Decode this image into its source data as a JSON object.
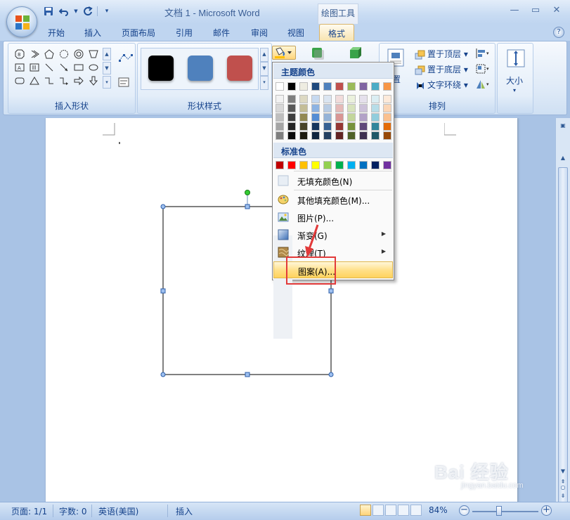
{
  "window": {
    "title": "文档 1 - Microsoft Word",
    "context_tab_group": "绘图工具",
    "controls": [
      "minimize",
      "maximize",
      "close"
    ]
  },
  "quick_access": {
    "items": [
      {
        "name": "save-icon"
      },
      {
        "name": "undo-icon"
      },
      {
        "name": "redo-icon"
      },
      {
        "name": "customize-icon"
      }
    ]
  },
  "tabs": [
    {
      "label": "开始"
    },
    {
      "label": "插入"
    },
    {
      "label": "页面布局"
    },
    {
      "label": "引用"
    },
    {
      "label": "邮件"
    },
    {
      "label": "审阅"
    },
    {
      "label": "视图"
    },
    {
      "label": "格式",
      "active": true
    }
  ],
  "ribbon": {
    "insert_shapes": {
      "label": "插入形状"
    },
    "shape_styles": {
      "label": "形状样式",
      "swatches": [
        {
          "color": "#000000"
        },
        {
          "color": "#4f81bd"
        },
        {
          "color": "#c0504d"
        }
      ]
    },
    "position_label": "置",
    "arrange": {
      "label": "排列",
      "items": [
        "置于顶层",
        "置于底层",
        "文字环绕"
      ]
    },
    "size": {
      "label": "大小"
    }
  },
  "fill_menu": {
    "theme_colors_header": "主题颜色",
    "theme_colors": [
      [
        "#ffffff",
        "#000000",
        "#eeece1",
        "#1f497d",
        "#4f81bd",
        "#c0504d",
        "#9bbb59",
        "#8064a2",
        "#4bacc6",
        "#f79646"
      ],
      [
        "#f2f2f2",
        "#7f7f7f",
        "#ddd9c3",
        "#c6d9f0",
        "#dbe5f1",
        "#f2dcdb",
        "#ebf1dd",
        "#e5e0ec",
        "#dbeef3",
        "#fdeada"
      ],
      [
        "#d8d8d8",
        "#595959",
        "#c4bd97",
        "#8db3e2",
        "#b8cce4",
        "#e5b9b7",
        "#d7e3bc",
        "#ccc1d9",
        "#b7dde8",
        "#fbd5b5"
      ],
      [
        "#bfbfbf",
        "#3f3f3f",
        "#938953",
        "#548dd4",
        "#95b3d7",
        "#d99694",
        "#c3d69b",
        "#b2a2c7",
        "#92cddc",
        "#fac08f"
      ],
      [
        "#a5a5a5",
        "#262626",
        "#494429",
        "#17365d",
        "#366092",
        "#953734",
        "#76923c",
        "#5f497a",
        "#31859b",
        "#e36c09"
      ],
      [
        "#7f7f7f",
        "#0c0c0c",
        "#1d1b10",
        "#0f243e",
        "#244061",
        "#632423",
        "#4f6128",
        "#3f3151",
        "#205867",
        "#974806"
      ]
    ],
    "standard_colors_header": "标准色",
    "standard_colors": [
      "#c00000",
      "#ff0000",
      "#ffc000",
      "#ffff00",
      "#92d050",
      "#00b050",
      "#00b0f0",
      "#0070c0",
      "#002060",
      "#7030a0"
    ],
    "items": [
      {
        "label": "无填充颜色(N)",
        "icon": "no-fill-icon"
      },
      {
        "label": "其他填充颜色(M)...",
        "icon": "palette-icon"
      },
      {
        "label": "图片(P)...",
        "icon": "picture-icon"
      },
      {
        "label": "渐变(G)",
        "icon": "gradient-icon",
        "submenu": true
      },
      {
        "label": "纹理(T)",
        "icon": "texture-icon",
        "submenu": true
      },
      {
        "label": "图案(A)...",
        "icon": "pattern-icon",
        "highlighted": true
      }
    ]
  },
  "status_bar": {
    "page": "页面: 1/1",
    "words": "字数: 0",
    "language": "英语(美国)",
    "mode": "插入",
    "zoom": "84%",
    "zoom_value": 0.84
  },
  "watermark": {
    "text": "Bai 经验",
    "sub": "jingyan.baidu.com"
  }
}
